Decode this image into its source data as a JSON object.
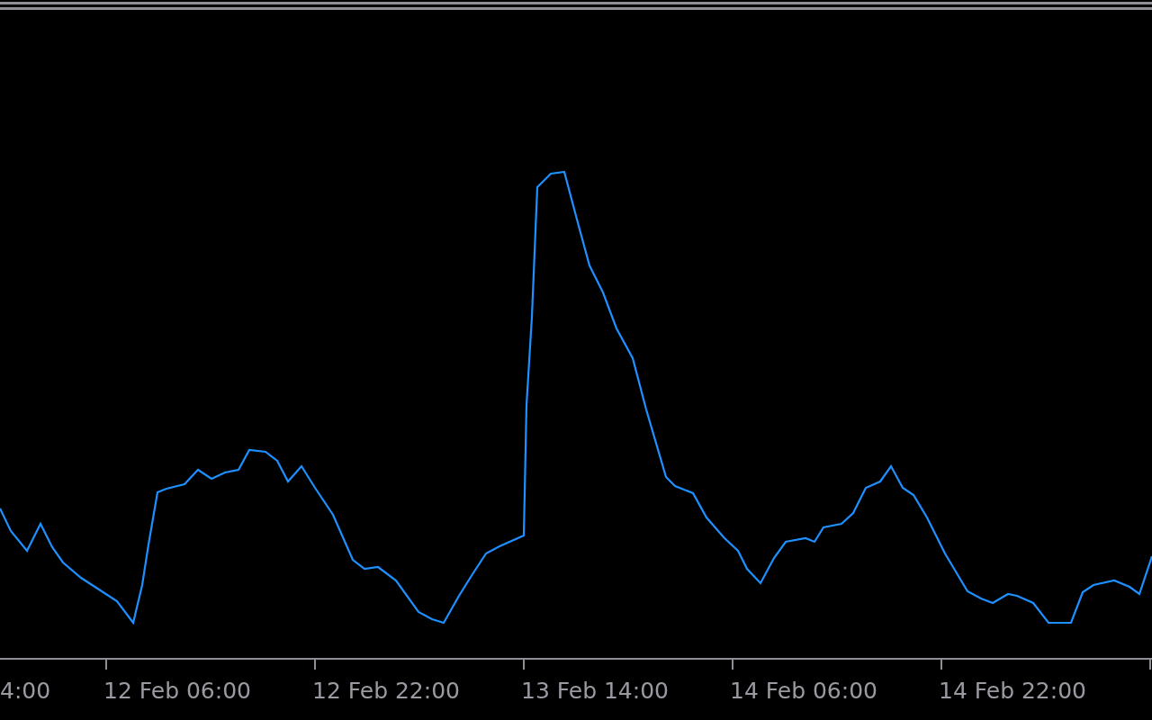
{
  "chart": {
    "x_labels": [
      "4:00",
      "12 Feb 06:00",
      "12 Feb 22:00",
      "13 Feb 14:00",
      "14 Feb 06:00",
      "14 Feb 22:00"
    ]
  }
}
